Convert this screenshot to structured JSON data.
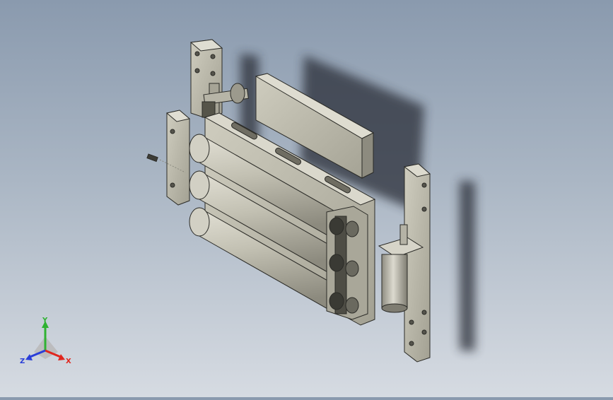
{
  "triad": {
    "x_label": "X",
    "y_label": "Y",
    "z_label": "Z",
    "x_color": "#e0261e",
    "y_color": "#2fb232",
    "z_color": "#2a3ed8"
  },
  "colors": {
    "part_light": "#c9c7ba",
    "part_mid": "#a8a698",
    "part_dark": "#6f6d62",
    "edge": "#2b2b27",
    "shadow": "#2a2f38"
  },
  "icons": {
    "triad": "view-orientation-triad-icon"
  }
}
